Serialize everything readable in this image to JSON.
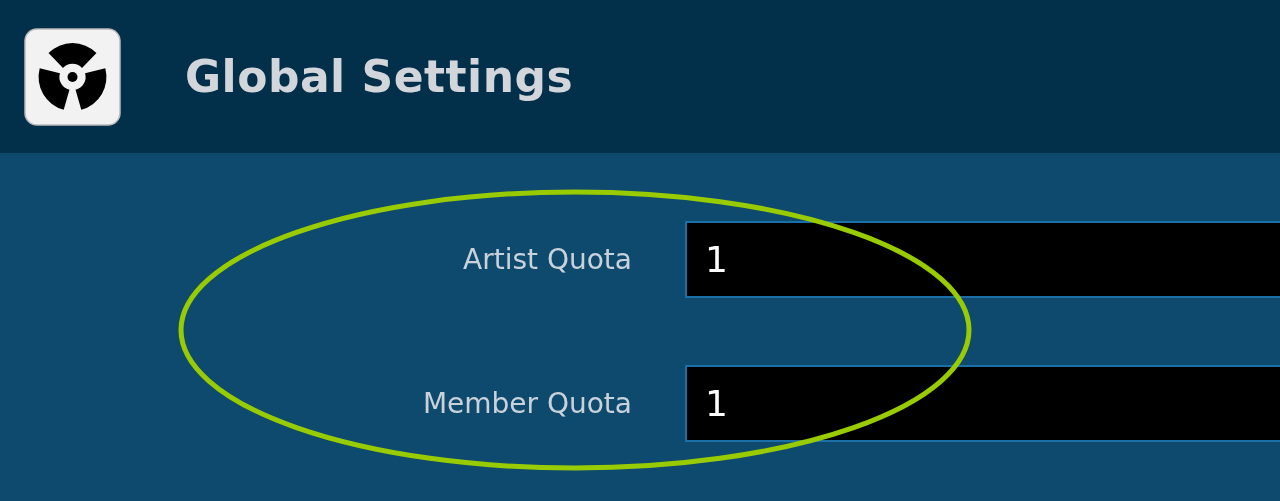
{
  "header": {
    "title": "Global Settings"
  },
  "fields": [
    {
      "label": "Artist Quota",
      "value": "1"
    },
    {
      "label": "Member Quota",
      "value": "1"
    }
  ]
}
